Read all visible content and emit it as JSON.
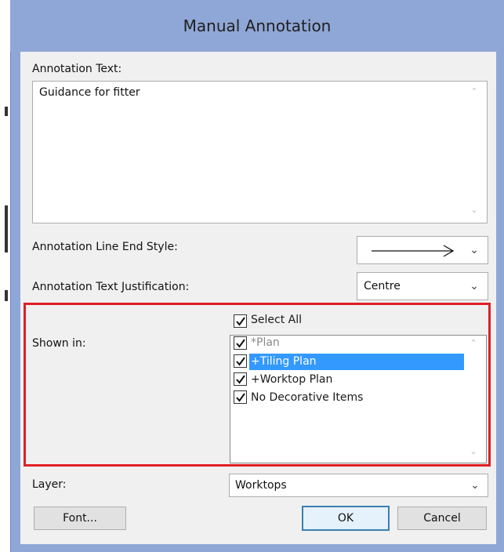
{
  "dialog": {
    "title": "Manual Annotation"
  },
  "annotation_text": {
    "label": "Annotation Text:",
    "value": "Guidance for fitter"
  },
  "line_end_style": {
    "label": "Annotation Line End Style:",
    "selected_icon": "long-arrow-right-icon"
  },
  "justification": {
    "label": "Annotation Text Justification:",
    "selected": "Centre"
  },
  "shown_in": {
    "label": "Shown in:",
    "select_all_label": "Select All",
    "select_all_checked": true,
    "items": [
      {
        "label": "*Plan",
        "checked": true,
        "disabled": true,
        "selected": false
      },
      {
        "label": "+Tiling Plan",
        "checked": true,
        "disabled": false,
        "selected": true
      },
      {
        "label": "+Worktop Plan",
        "checked": true,
        "disabled": false,
        "selected": false
      },
      {
        "label": "No Decorative Items",
        "checked": true,
        "disabled": false,
        "selected": false
      }
    ]
  },
  "layer": {
    "label": "Layer:",
    "selected": "Worktops"
  },
  "buttons": {
    "font": "Font...",
    "ok": "OK",
    "cancel": "Cancel"
  },
  "colors": {
    "title_bar": "#8fa7d6",
    "highlight_box": "#e01f26",
    "selection": "#3399ff",
    "dialog_bg": "#f0f0f0"
  }
}
